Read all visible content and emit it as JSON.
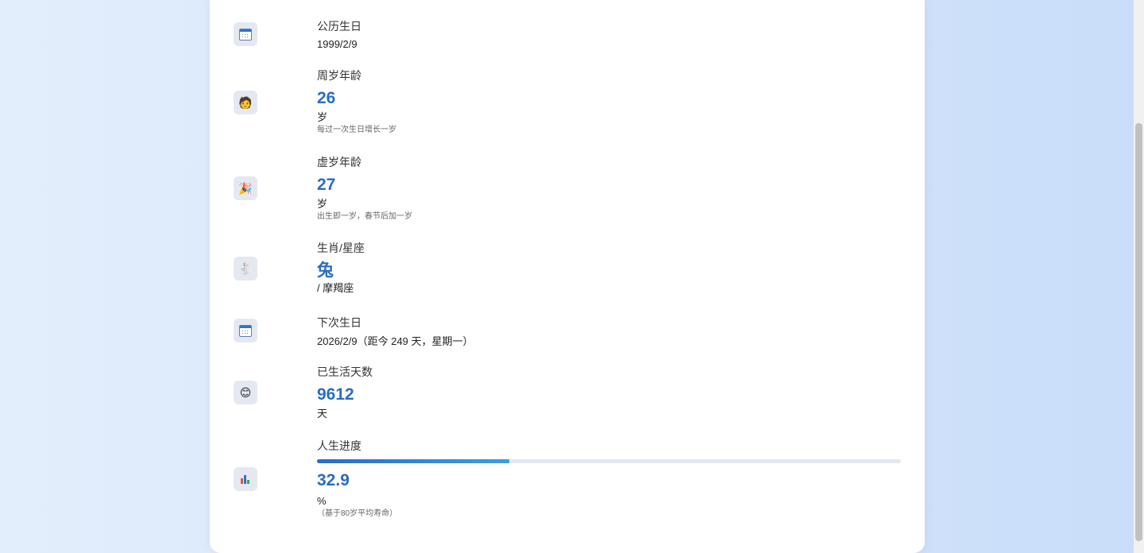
{
  "items": [
    {
      "label": "公历生日",
      "value": "1999/2/9",
      "icon": "calendar-icon"
    },
    {
      "label": "周岁年龄",
      "value": "26",
      "unit": "岁",
      "note": "每过一次生日增长一岁",
      "icon": "face-icon"
    },
    {
      "label": "虚岁年龄",
      "value": "27",
      "unit": "岁",
      "note": "出生即一岁，春节后加一岁",
      "icon": "party-popper-icon"
    },
    {
      "label": "生肖/星座",
      "value": "兔",
      "unit": "/ 摩羯座",
      "icon": "rabbit-icon"
    },
    {
      "label": "下次生日",
      "value": "2026/2/9（距今 249 天，星期一）",
      "icon": "calendar-icon"
    },
    {
      "label": "已生活天数",
      "value": "9612",
      "unit": "天",
      "icon": "smiling-face-icon"
    },
    {
      "label": "人生进度",
      "value": "32.9",
      "unit": "%",
      "note": "（基于80岁平均寿命）",
      "progress": 0.329,
      "icon": "bar-chart-icon"
    }
  ],
  "colors": {
    "accent": "#2a6cc4",
    "progress_end": "#3aa0dc",
    "track": "#e2e8f0"
  }
}
